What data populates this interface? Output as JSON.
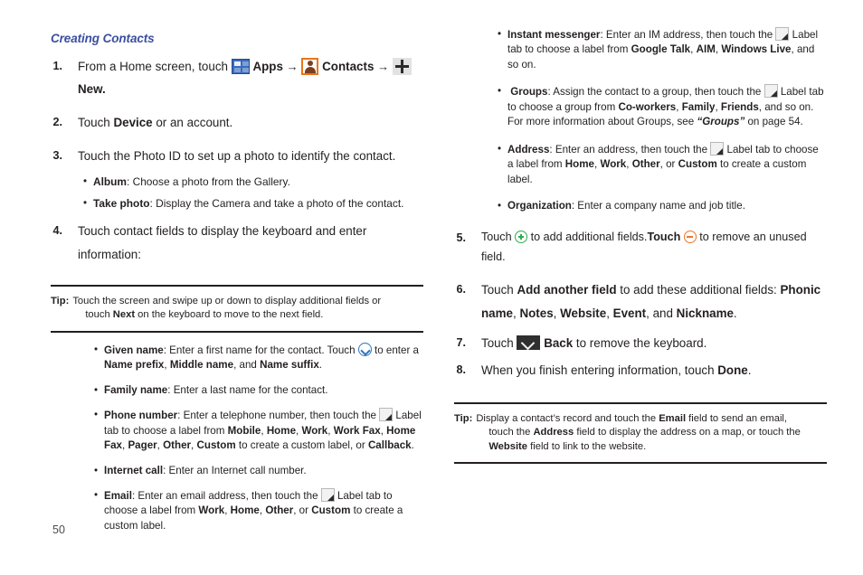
{
  "document": {
    "page_number": "50",
    "heading_color": "#3b4ea0"
  },
  "left_column": {
    "section_title": "Creating Contacts",
    "steps": [
      {
        "number": "1.",
        "parts": {
          "t1": "From a Home screen, touch",
          "apps_label": "Apps",
          "arrow1": "→",
          "contacts_label": "Contacts",
          "arrow2": "→",
          "new_label": "New."
        },
        "icons": [
          "apps-grid-icon",
          "contacts-person-icon",
          "plus-icon"
        ]
      },
      {
        "number": "2.",
        "parts": {
          "t1": "Touch ",
          "b1": "Device",
          "t2": " or an account."
        }
      },
      {
        "number": "3.",
        "parts": {
          "t1": "Touch the Photo ID to set up a photo to identify the contact."
        },
        "bullets": [
          {
            "term": "Album",
            "text": ": Choose a photo from the Gallery."
          },
          {
            "term": "Take photo",
            "text": ": Display the Camera and take a photo of the contact."
          }
        ]
      },
      {
        "number": "4.",
        "parts": {
          "t1": "Touch contact fields to display the keyboard and enter information:"
        }
      }
    ],
    "tip": {
      "label": "Tip:",
      "line1_a": "Touch the screen and swipe up or down to display additional fields or",
      "line2_a": "touch ",
      "line2_b": "Next",
      "line2_c": " on the keyboard to move to the next field."
    },
    "fields": [
      {
        "term": "Given name",
        "seg1": ": Enter a first name for the contact. Touch ",
        "icon": "chevron-down-circle-icon",
        "seg2": " to enter a ",
        "b1": "Name prefix",
        "seg3": ", ",
        "b2": "Middle name",
        "seg4": ", and ",
        "b3": "Name suffix",
        "seg5": "."
      },
      {
        "term": "Family name",
        "seg1": ": Enter a last name for the contact."
      },
      {
        "term": "Phone number",
        "seg1": ": Enter a telephone number, then touch the ",
        "icon": "label-tab-icon",
        "seg2": " Label tab to choose a label from ",
        "b1": "Mobile",
        "s1": ", ",
        "b2": "Home",
        "s2": ", ",
        "b3": "Work",
        "s3": ", ",
        "b4": "Work Fax",
        "s4": ", ",
        "b5": "Home Fax",
        "s5": ", ",
        "b6": "Pager",
        "s6": ", ",
        "b7": "Other",
        "s7": ", ",
        "b8": "Custom",
        "s8": " to create a custom label, or ",
        "b9": "Callback",
        "s9": "."
      },
      {
        "term": "Internet call",
        "seg1": ": Enter an Internet call number."
      },
      {
        "term": "Email",
        "seg1": ": Enter an email address, then touch the ",
        "icon": "label-tab-icon",
        "seg2": " Label tab to choose a label from ",
        "b1": "Work",
        "s1": ", ",
        "b2": "Home",
        "s2": ", ",
        "b3": "Other",
        "s3": ", or ",
        "b4": "Custom",
        "s4": " to create a custom label."
      }
    ]
  },
  "right_column": {
    "fields": [
      {
        "term": "Instant messenger",
        "seg1": ": Enter an IM address, then touch the ",
        "icon": "label-tab-icon",
        "seg2": " Label tab to choose a label from ",
        "b1": "Google Talk",
        "s1": ", ",
        "b2": "AIM",
        "s2": ", ",
        "b3": "Windows Live",
        "s3": ", and so on."
      },
      {
        "term": "Groups",
        "seg1": ": Assign the contact to a group, then touch the ",
        "icon": "label-tab-icon",
        "seg2": " Label tab to choose a group from ",
        "b1": "Co-workers",
        "s1": ", ",
        "b2": "Family",
        "s2": ", ",
        "b3": "Friends",
        "s3": ", and so on. For more information about Groups, see ",
        "ital": "“Groups”",
        "s4": " on page 54."
      },
      {
        "term": "Address",
        "seg1": ": Enter an address, then touch the ",
        "icon": "label-tab-icon",
        "seg2": " Label tab to choose a label from ",
        "b1": "Home",
        "s1": ", ",
        "b2": "Work",
        "s2": ", ",
        "b3": "Other",
        "s3": ", or ",
        "b4": "Custom",
        "s4": " to create a custom label."
      },
      {
        "term": "Organization",
        "seg1": ": Enter a company name and job title."
      }
    ],
    "steps": [
      {
        "number": "5.",
        "t1": "Touch ",
        "icon_add": "add-circle-icon",
        "t2": " to add additional fields.",
        "b1": "Touch",
        "t3": " ",
        "icon_rem": "remove-circle-icon",
        "t4": " to remove an unused field."
      },
      {
        "number": "6.",
        "t1": "Touch ",
        "b1": "Add another field",
        "t2": " to add these additional fields: ",
        "b2": "Phonic name",
        "s2": ", ",
        "b3": "Notes",
        "s3": ", ",
        "b4": "Website",
        "s4": ", ",
        "b5": "Event",
        "s5": ", and ",
        "b6": "Nickname",
        "s6": "."
      },
      {
        "number": "7.",
        "t1": "Touch ",
        "icon_back": "back-icon",
        "t2": " ",
        "b1": "Back",
        "t3": " to remove the keyboard."
      },
      {
        "number": "8.",
        "t1": "When you finish entering information, touch ",
        "b1": "Done",
        "t2": "."
      }
    ],
    "tip": {
      "label": "Tip:",
      "l1_a": "Display a contact’s record and touch the ",
      "l1_b": "Email",
      "l1_c": " field to send an email,",
      "l2_a": "touch the ",
      "l2_b": "Address",
      "l2_c": " field to display the address on a map, or touch the",
      "l3_a": "",
      "l3_b": "Website",
      "l3_c": " field to link to the website."
    }
  }
}
